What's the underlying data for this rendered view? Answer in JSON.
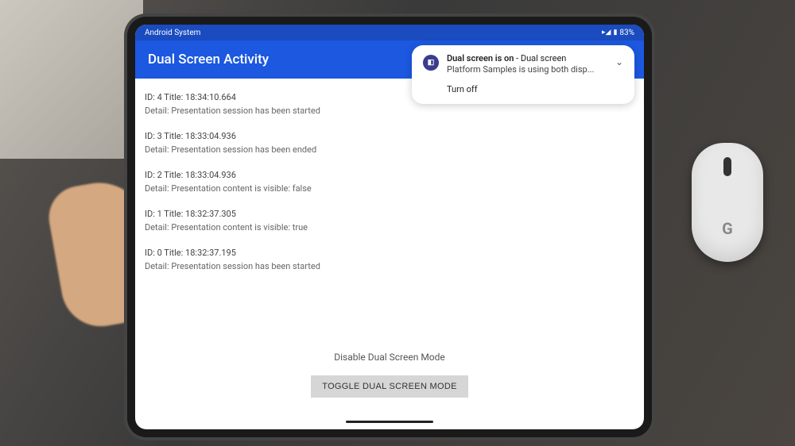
{
  "statusBar": {
    "systemLabel": "Android System",
    "battery": "83%"
  },
  "appBar": {
    "title": "Dual Screen Activity"
  },
  "logs": [
    {
      "title": "ID: 4 Title: 18:34:10.664",
      "detail": "Detail: Presentation session has been started"
    },
    {
      "title": "ID: 3 Title: 18:33:04.936",
      "detail": "Detail: Presentation session has been ended"
    },
    {
      "title": "ID: 2 Title: 18:33:04.936",
      "detail": "Detail: Presentation content is visible: false"
    },
    {
      "title": "ID: 1 Title: 18:32:37.305",
      "detail": "Detail: Presentation content is visible: true"
    },
    {
      "title": "ID: 0 Title: 18:32:37.195",
      "detail": "Detail: Presentation session has been started"
    }
  ],
  "bottom": {
    "modeLabel": "Disable Dual Screen Mode",
    "toggleButton": "TOGGLE DUAL SCREEN MODE"
  },
  "notification": {
    "titleBold": "Dual screen is on",
    "titleRest": " - Dual screen",
    "subtitle": "Platform Samples is using both disp...",
    "action": "Turn off"
  }
}
